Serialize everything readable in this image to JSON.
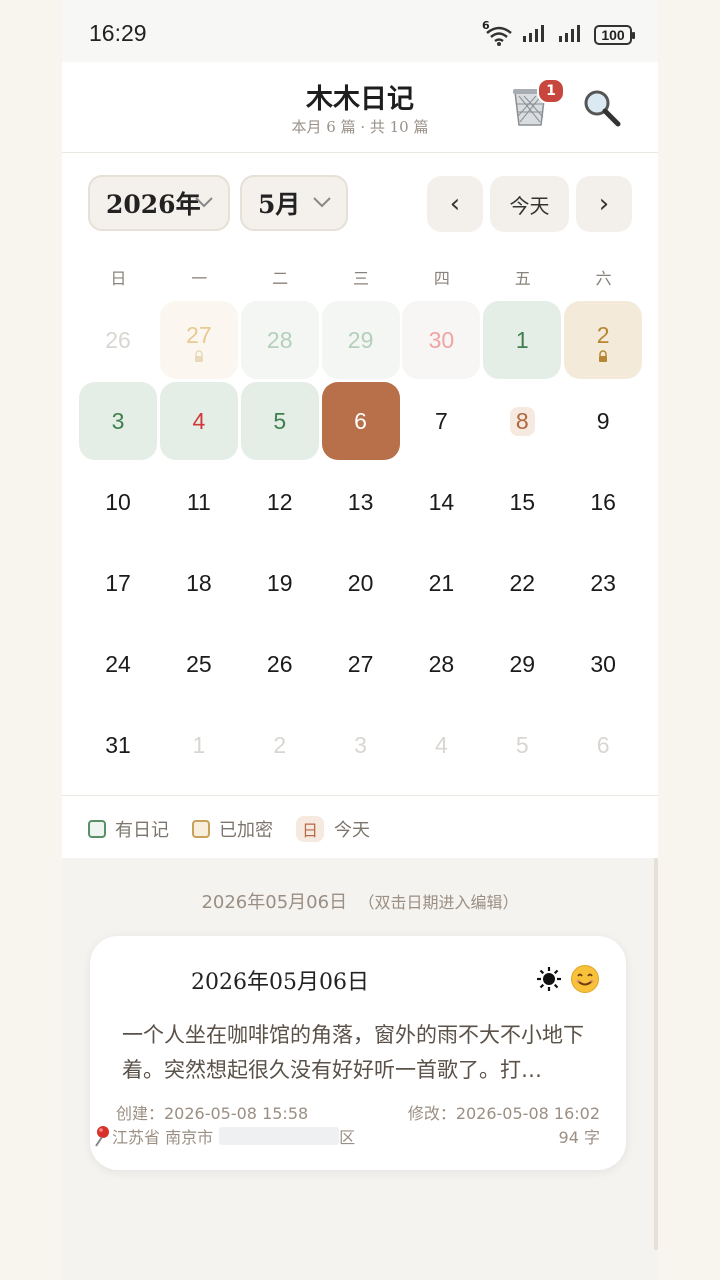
{
  "status": {
    "time": "16:29",
    "battery": "100",
    "network": "6"
  },
  "header": {
    "title": "木木日记",
    "subtitle": "本月 6 篇 · 共 10 篇",
    "trash_badge": "1"
  },
  "calendar": {
    "year_select": "2026年",
    "month_select": "5月",
    "prev_label": "‹",
    "today_label": "今天",
    "next_label": "›",
    "weekdays": [
      "日",
      "一",
      "二",
      "三",
      "四",
      "五",
      "六"
    ],
    "weeks": [
      [
        {
          "d": "26",
          "s": "out"
        },
        {
          "d": "27",
          "s": "out-locked"
        },
        {
          "d": "28",
          "s": "out-diary"
        },
        {
          "d": "29",
          "s": "out-diary"
        },
        {
          "d": "30",
          "s": "out-diary-red"
        },
        {
          "d": "1",
          "s": "diary"
        },
        {
          "d": "2",
          "s": "locked"
        }
      ],
      [
        {
          "d": "3",
          "s": "diary"
        },
        {
          "d": "4",
          "s": "diary-red"
        },
        {
          "d": "5",
          "s": "diary"
        },
        {
          "d": "6",
          "s": "selected"
        },
        {
          "d": "7",
          "s": "normal"
        },
        {
          "d": "8",
          "s": "today"
        },
        {
          "d": "9",
          "s": "normal"
        }
      ],
      [
        {
          "d": "10",
          "s": "normal"
        },
        {
          "d": "11",
          "s": "normal"
        },
        {
          "d": "12",
          "s": "normal"
        },
        {
          "d": "13",
          "s": "normal"
        },
        {
          "d": "14",
          "s": "normal"
        },
        {
          "d": "15",
          "s": "normal"
        },
        {
          "d": "16",
          "s": "normal"
        }
      ],
      [
        {
          "d": "17",
          "s": "normal"
        },
        {
          "d": "18",
          "s": "normal"
        },
        {
          "d": "19",
          "s": "normal"
        },
        {
          "d": "20",
          "s": "normal"
        },
        {
          "d": "21",
          "s": "normal"
        },
        {
          "d": "22",
          "s": "normal"
        },
        {
          "d": "23",
          "s": "normal"
        }
      ],
      [
        {
          "d": "24",
          "s": "normal"
        },
        {
          "d": "25",
          "s": "normal"
        },
        {
          "d": "26",
          "s": "normal"
        },
        {
          "d": "27",
          "s": "normal"
        },
        {
          "d": "28",
          "s": "normal"
        },
        {
          "d": "29",
          "s": "normal"
        },
        {
          "d": "30",
          "s": "normal"
        }
      ],
      [
        {
          "d": "31",
          "s": "normal"
        },
        {
          "d": "1",
          "s": "out"
        },
        {
          "d": "2",
          "s": "out"
        },
        {
          "d": "3",
          "s": "out"
        },
        {
          "d": "4",
          "s": "out"
        },
        {
          "d": "5",
          "s": "out"
        },
        {
          "d": "6",
          "s": "out"
        }
      ]
    ]
  },
  "legend": {
    "diary": "有日记",
    "locked": "已加密",
    "today_mark": "日",
    "today": "今天"
  },
  "selected": {
    "date_line": "2026年05月06日",
    "hint": "（双击日期进入编辑）",
    "card": {
      "date": "2026年05月06日",
      "weather_icon": "sun-icon",
      "mood_icon": "smile-icon",
      "excerpt": "一个人坐在咖啡馆的角落，窗外的雨不大不小地下着。突然想起很久没有好好听一首歌了。打…",
      "created": "创建：2026-05-08 15:58",
      "modified": "修改：2026-05-08 16:02",
      "location": "江苏省 南京市",
      "location_tail": "区",
      "word_count": "94 字"
    }
  },
  "colors": {
    "accent": "#b8704a",
    "diary_green": "#4a8a5c",
    "locked_gold": "#c9a15a",
    "red": "#d0393b"
  }
}
